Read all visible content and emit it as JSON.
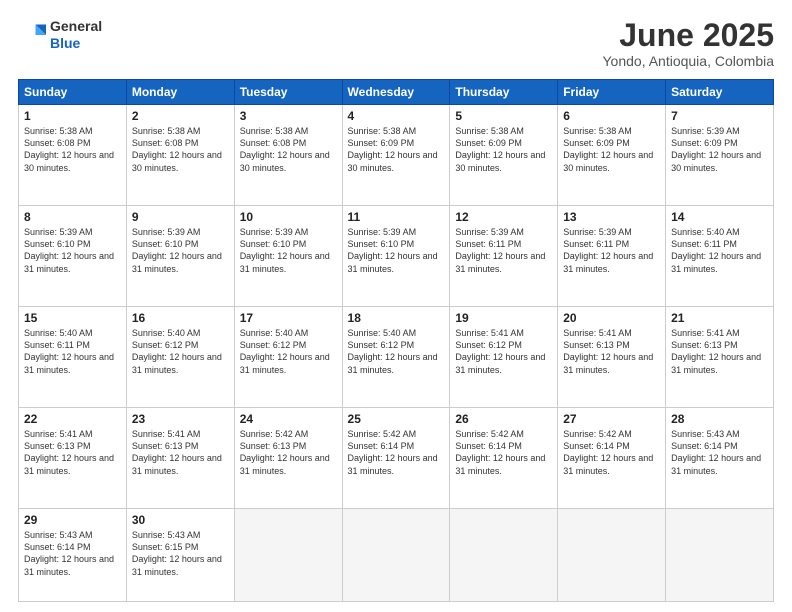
{
  "header": {
    "logo_line1": "General",
    "logo_line2": "Blue",
    "month": "June 2025",
    "location": "Yondo, Antioquia, Colombia"
  },
  "weekdays": [
    "Sunday",
    "Monday",
    "Tuesday",
    "Wednesday",
    "Thursday",
    "Friday",
    "Saturday"
  ],
  "weeks": [
    [
      {
        "day": "1",
        "sunrise": "5:38 AM",
        "sunset": "6:08 PM",
        "daylight": "12 hours and 30 minutes."
      },
      {
        "day": "2",
        "sunrise": "5:38 AM",
        "sunset": "6:08 PM",
        "daylight": "12 hours and 30 minutes."
      },
      {
        "day": "3",
        "sunrise": "5:38 AM",
        "sunset": "6:08 PM",
        "daylight": "12 hours and 30 minutes."
      },
      {
        "day": "4",
        "sunrise": "5:38 AM",
        "sunset": "6:09 PM",
        "daylight": "12 hours and 30 minutes."
      },
      {
        "day": "5",
        "sunrise": "5:38 AM",
        "sunset": "6:09 PM",
        "daylight": "12 hours and 30 minutes."
      },
      {
        "day": "6",
        "sunrise": "5:38 AM",
        "sunset": "6:09 PM",
        "daylight": "12 hours and 30 minutes."
      },
      {
        "day": "7",
        "sunrise": "5:39 AM",
        "sunset": "6:09 PM",
        "daylight": "12 hours and 30 minutes."
      }
    ],
    [
      {
        "day": "8",
        "sunrise": "5:39 AM",
        "sunset": "6:10 PM",
        "daylight": "12 hours and 31 minutes."
      },
      {
        "day": "9",
        "sunrise": "5:39 AM",
        "sunset": "6:10 PM",
        "daylight": "12 hours and 31 minutes."
      },
      {
        "day": "10",
        "sunrise": "5:39 AM",
        "sunset": "6:10 PM",
        "daylight": "12 hours and 31 minutes."
      },
      {
        "day": "11",
        "sunrise": "5:39 AM",
        "sunset": "6:10 PM",
        "daylight": "12 hours and 31 minutes."
      },
      {
        "day": "12",
        "sunrise": "5:39 AM",
        "sunset": "6:11 PM",
        "daylight": "12 hours and 31 minutes."
      },
      {
        "day": "13",
        "sunrise": "5:39 AM",
        "sunset": "6:11 PM",
        "daylight": "12 hours and 31 minutes."
      },
      {
        "day": "14",
        "sunrise": "5:40 AM",
        "sunset": "6:11 PM",
        "daylight": "12 hours and 31 minutes."
      }
    ],
    [
      {
        "day": "15",
        "sunrise": "5:40 AM",
        "sunset": "6:11 PM",
        "daylight": "12 hours and 31 minutes."
      },
      {
        "day": "16",
        "sunrise": "5:40 AM",
        "sunset": "6:12 PM",
        "daylight": "12 hours and 31 minutes."
      },
      {
        "day": "17",
        "sunrise": "5:40 AM",
        "sunset": "6:12 PM",
        "daylight": "12 hours and 31 minutes."
      },
      {
        "day": "18",
        "sunrise": "5:40 AM",
        "sunset": "6:12 PM",
        "daylight": "12 hours and 31 minutes."
      },
      {
        "day": "19",
        "sunrise": "5:41 AM",
        "sunset": "6:12 PM",
        "daylight": "12 hours and 31 minutes."
      },
      {
        "day": "20",
        "sunrise": "5:41 AM",
        "sunset": "6:13 PM",
        "daylight": "12 hours and 31 minutes."
      },
      {
        "day": "21",
        "sunrise": "5:41 AM",
        "sunset": "6:13 PM",
        "daylight": "12 hours and 31 minutes."
      }
    ],
    [
      {
        "day": "22",
        "sunrise": "5:41 AM",
        "sunset": "6:13 PM",
        "daylight": "12 hours and 31 minutes."
      },
      {
        "day": "23",
        "sunrise": "5:41 AM",
        "sunset": "6:13 PM",
        "daylight": "12 hours and 31 minutes."
      },
      {
        "day": "24",
        "sunrise": "5:42 AM",
        "sunset": "6:13 PM",
        "daylight": "12 hours and 31 minutes."
      },
      {
        "day": "25",
        "sunrise": "5:42 AM",
        "sunset": "6:14 PM",
        "daylight": "12 hours and 31 minutes."
      },
      {
        "day": "26",
        "sunrise": "5:42 AM",
        "sunset": "6:14 PM",
        "daylight": "12 hours and 31 minutes."
      },
      {
        "day": "27",
        "sunrise": "5:42 AM",
        "sunset": "6:14 PM",
        "daylight": "12 hours and 31 minutes."
      },
      {
        "day": "28",
        "sunrise": "5:43 AM",
        "sunset": "6:14 PM",
        "daylight": "12 hours and 31 minutes."
      }
    ],
    [
      {
        "day": "29",
        "sunrise": "5:43 AM",
        "sunset": "6:14 PM",
        "daylight": "12 hours and 31 minutes."
      },
      {
        "day": "30",
        "sunrise": "5:43 AM",
        "sunset": "6:15 PM",
        "daylight": "12 hours and 31 minutes."
      },
      null,
      null,
      null,
      null,
      null
    ]
  ]
}
